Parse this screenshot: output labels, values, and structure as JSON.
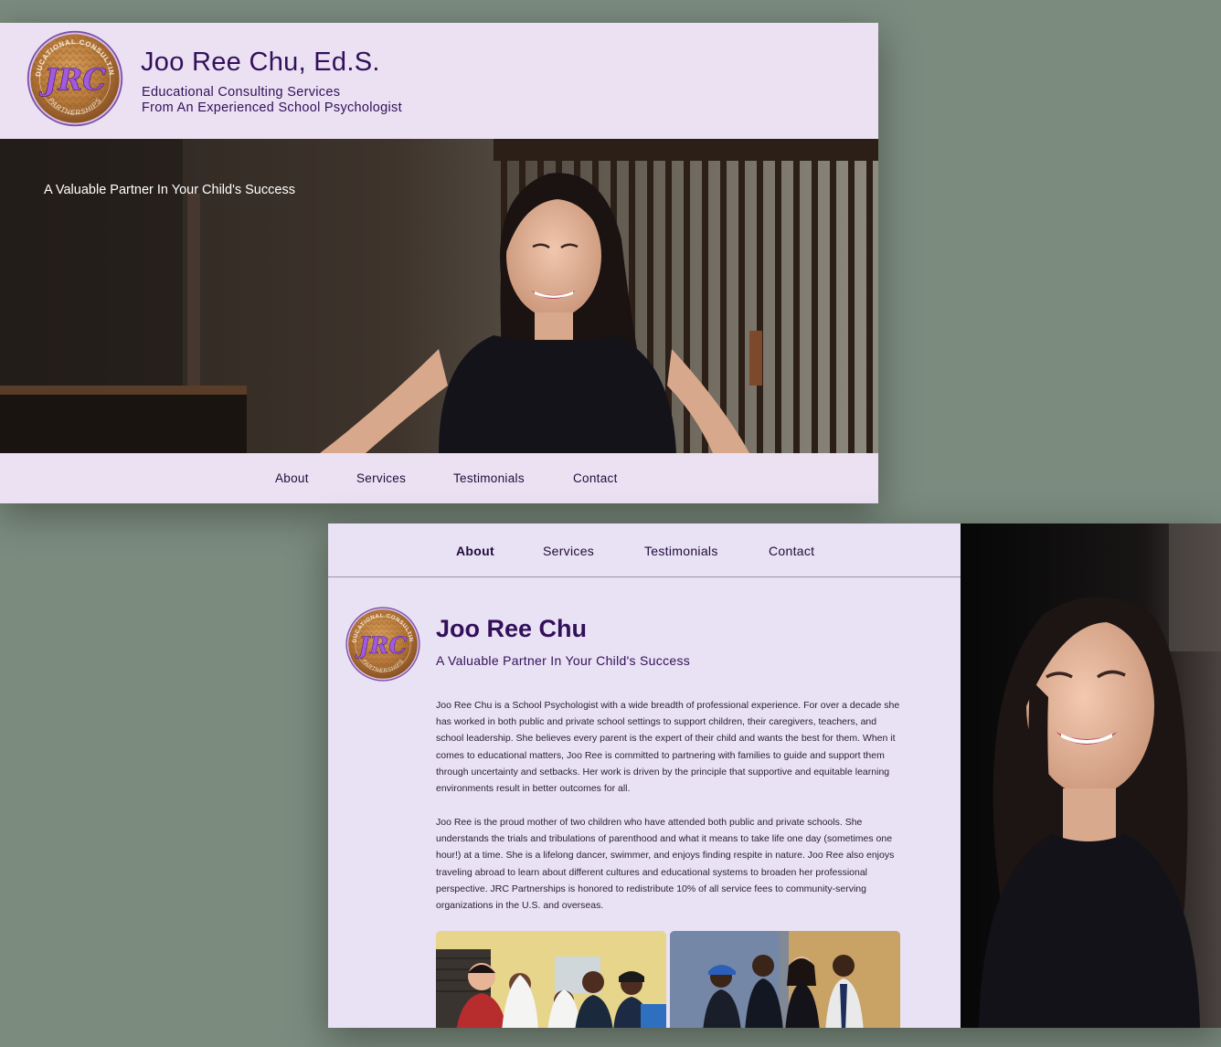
{
  "top_window": {
    "header": {
      "title": "Joo Ree Chu, Ed.S.",
      "subtitle_line1": "Educational Consulting Services",
      "subtitle_line2": "From An Experienced School Psychologist"
    },
    "logo": {
      "ring_top_text": "EDUCATIONAL CONSULTING",
      "ring_bottom_text": "PARTNERSHIPS",
      "monogram": "JRC"
    },
    "hero": {
      "tagline": "A Valuable Partner In Your Child's Success"
    },
    "nav": {
      "items": [
        "About",
        "Services",
        "Testimonials",
        "Contact"
      ]
    }
  },
  "bottom_window": {
    "nav": {
      "items": [
        "About",
        "Services",
        "Testimonials",
        "Contact"
      ],
      "active": "About"
    },
    "about": {
      "name": "Joo Ree Chu",
      "tagline": "A Valuable Partner In Your Child's Success",
      "paragraph1": "Joo Ree Chu is a School Psychologist with a wide breadth of professional experience. For over a decade she has worked in both public and private school settings to support children, their caregivers, teachers, and school leadership. She believes every parent is the expert of their child and wants the best for them. When it comes to educational matters, Joo Ree is committed to partnering with families to guide and support them through uncertainty and setbacks. Her work is driven by the principle that supportive and equitable learning environments result in better outcomes for all.",
      "paragraph2": "Joo Ree is the proud mother of two children who have attended both public and private schools. She understands the trials and tribulations of parenthood and what it means to take life one day (sometimes one hour!) at a time. She is a lifelong dancer, swimmer, and enjoys finding respite in nature. Joo Ree also enjoys traveling abroad to learn about different cultures and educational systems to broaden her professional perspective. JRC Partnerships is honored to redistribute 10% of all service fees to community-serving organizations in the U.S. and overseas."
    }
  },
  "colors": {
    "page_background": "#7b8b7e",
    "panel_background": "#ebe1f3",
    "brand_purple": "#33105a",
    "logo_purple": "#a05be0",
    "logo_gold": "#b98040"
  }
}
